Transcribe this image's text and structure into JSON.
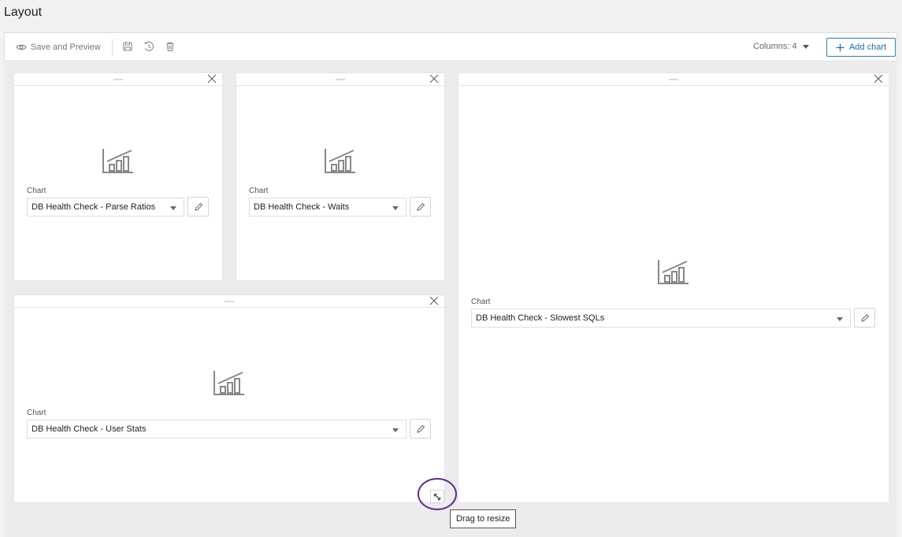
{
  "page": {
    "title": "Layout"
  },
  "toolbar": {
    "save_preview_label": "Save and Preview",
    "columns_label": "Columns: 4",
    "add_chart_label": "Add chart"
  },
  "field_label": "Chart",
  "cards": [
    {
      "chart": "DB Health Check - Parse Ratios"
    },
    {
      "chart": "DB Health Check - Waits"
    },
    {
      "chart": "DB Health Check - Slowest SQLs"
    },
    {
      "chart": "DB Health Check - User Stats"
    }
  ],
  "tooltip": {
    "text": "Drag to resize"
  },
  "colors": {
    "accent": "#1f6aa5",
    "highlight": "#5b2c8a"
  },
  "icons": [
    "eye-icon",
    "save-icon",
    "history-icon",
    "trash-icon",
    "caret-down-icon",
    "plus-icon",
    "drag-handle-icon",
    "close-icon",
    "chart-placeholder-icon",
    "pencil-icon",
    "resize-icon"
  ]
}
